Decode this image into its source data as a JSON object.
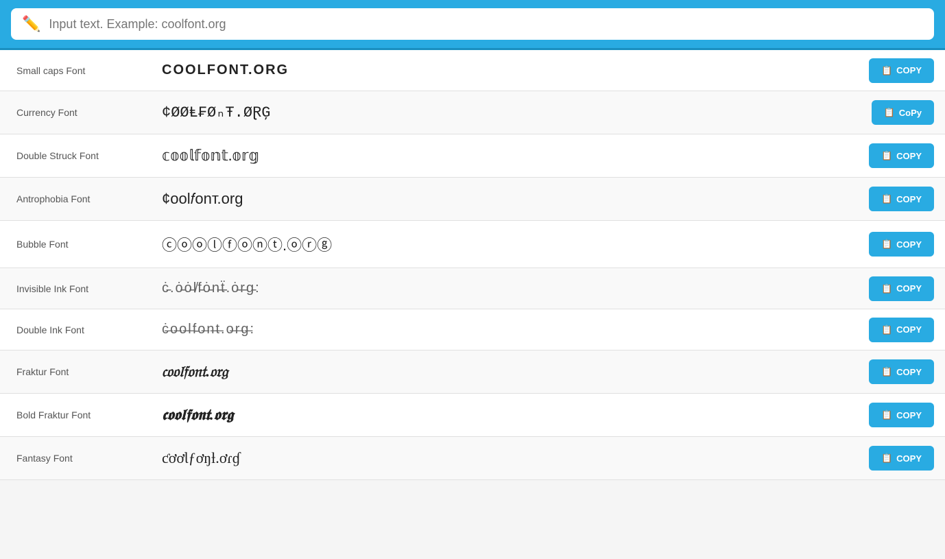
{
  "header": {
    "search_placeholder": "Input text. Example: coolfont.org",
    "pencil_icon": "✏️"
  },
  "fonts": [
    {
      "label": "Small caps Font",
      "preview": "COOLFONT.ORG",
      "style": "small-caps",
      "copy_label": "COPY"
    },
    {
      "label": "Currency Font",
      "preview": "¢ØØⱠ₣ØₙŦ.ØⱤĢ",
      "style": "currency",
      "copy_label": "CoPy"
    },
    {
      "label": "Double Struck Font",
      "preview": "𝕔𝕠𝕠𝕝𝕗𝕠𝕟𝕥.𝕠𝕣𝕘",
      "style": "double-struck",
      "copy_label": "COPY"
    },
    {
      "label": "Antrophobia Font",
      "preview": "¢ool𝑓onт.org",
      "style": "antrophobia",
      "copy_label": "COPY"
    },
    {
      "label": "Bubble Font",
      "preview": "ⓒⓞⓞⓛⓕⓞⓝⓣ.ⓞⓡⓖ",
      "style": "bubble",
      "copy_label": "COPY"
    },
    {
      "label": "Invisible Ink Font",
      "preview": "ċ̵.ȯ̵ȯ̵l̸f̵ȯ̵n̵ẗ̵.ȯ̵r̵g̵:",
      "style": "invisible",
      "copy_label": "COPY"
    },
    {
      "label": "Double Ink Font",
      "preview": "ċ̶o̶o̶l̶f̵o̶n̶t̶.o̶r̶g̶:",
      "style": "double-ink",
      "copy_label": "COPY"
    },
    {
      "label": "Fraktur Font",
      "preview": "𝔠𝔬𝔬𝔩𝔣𝔬𝔫𝔱.𝔬𝔯𝔤",
      "style": "fraktur",
      "copy_label": "COPY"
    },
    {
      "label": "Bold Fraktur Font",
      "preview": "𝖈𝖔𝖔𝖑𝖋𝖔𝖓𝖙.𝖔𝖗𝖌",
      "style": "bold-fraktur",
      "copy_label": "COPY"
    },
    {
      "label": "Fantasy Font",
      "preview": "ƈơơƖƒơŋƚ.ơɾɠ",
      "style": "fantasy",
      "copy_label": "COPY"
    }
  ],
  "copy_icon": "📋"
}
